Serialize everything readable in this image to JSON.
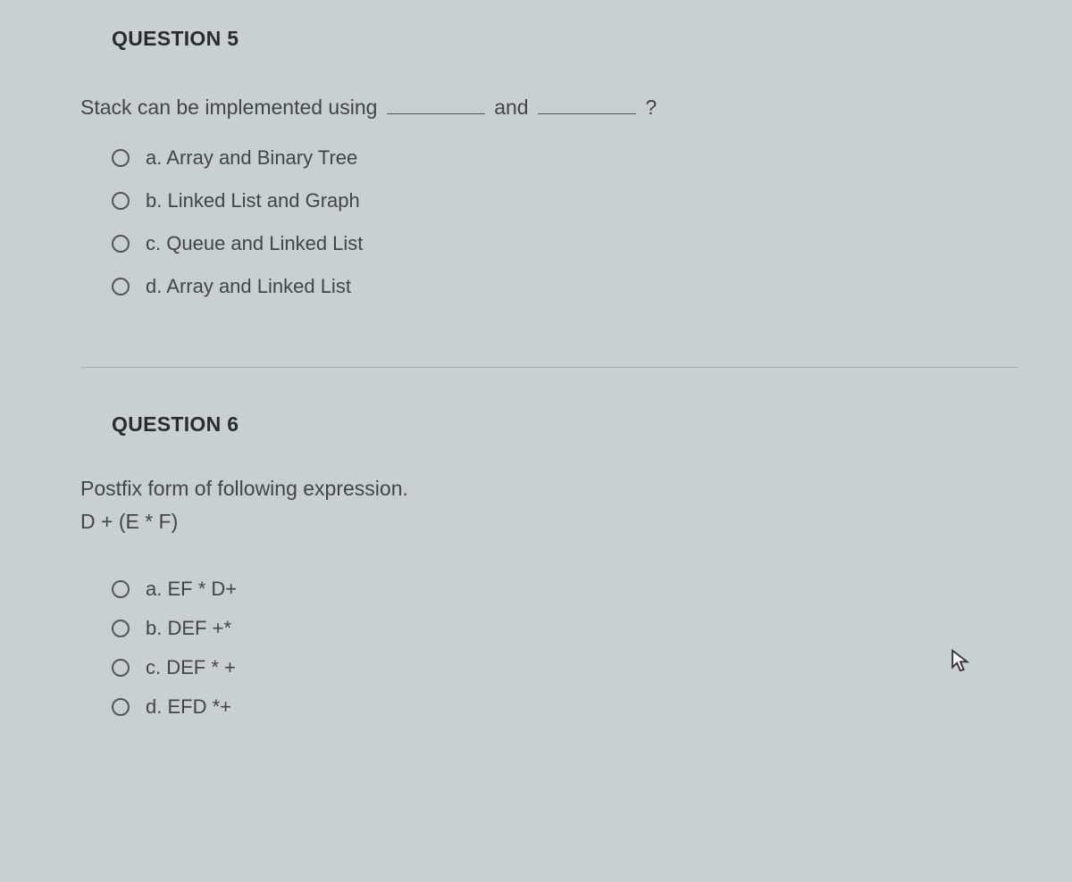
{
  "questions": [
    {
      "title": "QUESTION 5",
      "text_parts": [
        "Stack can be implemented using",
        "and",
        "?"
      ],
      "options": [
        {
          "letter": "a.",
          "text": "Array and Binary Tree"
        },
        {
          "letter": "b.",
          "text": "Linked List and Graph"
        },
        {
          "letter": "c.",
          "text": "Queue and Linked List"
        },
        {
          "letter": "d.",
          "text": "Array and Linked List"
        }
      ]
    },
    {
      "title": "QUESTION 6",
      "text_parts": [
        "Postfix form of following expression.",
        "D + (E * F)"
      ],
      "options": [
        {
          "letter": "a.",
          "text": "EF * D+"
        },
        {
          "letter": "b.",
          "text": "DEF +*"
        },
        {
          "letter": "c.",
          "text": "DEF * +"
        },
        {
          "letter": "d.",
          "text": "EFD *+"
        }
      ]
    }
  ]
}
